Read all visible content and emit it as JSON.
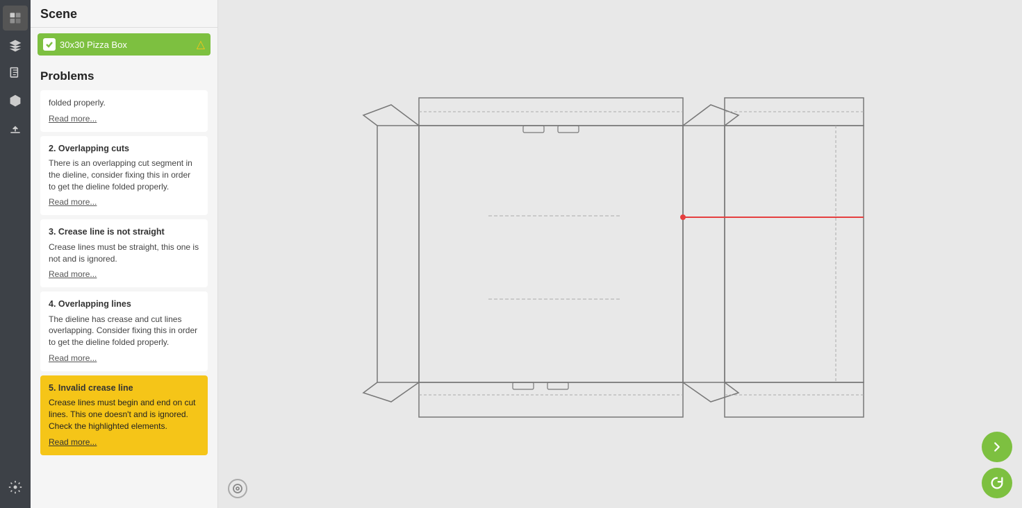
{
  "toolbar": {
    "title": "Scene",
    "tools": [
      {
        "name": "logo",
        "label": "Logo"
      },
      {
        "name": "layers",
        "label": "Layers"
      },
      {
        "name": "files",
        "label": "Files"
      },
      {
        "name": "models",
        "label": "Models"
      },
      {
        "name": "upload",
        "label": "Upload"
      }
    ],
    "settings_label": "Settings"
  },
  "sidebar": {
    "scene_title": "Scene",
    "item_label": "30x30 Pizza Box",
    "problems_title": "Problems",
    "problems": [
      {
        "id": 1,
        "title": null,
        "desc": "folded properly.",
        "read_more": "Read more...",
        "highlighted": false
      },
      {
        "id": 2,
        "title": "2. Overlapping cuts",
        "desc": "There is an overlapping cut segment in the dieline, consider fixing this in order to get the dieline folded properly.",
        "read_more": "Read more...",
        "highlighted": false
      },
      {
        "id": 3,
        "title": "3. Crease line is not straight",
        "desc": "Crease lines must be straight, this one is not and is ignored.",
        "read_more": "Read more...",
        "highlighted": false
      },
      {
        "id": 4,
        "title": "4. Overlapping lines",
        "desc": "The dieline has crease and cut lines overlapping. Consider fixing this in order to get the dieline folded properly.",
        "read_more": "Read more...",
        "highlighted": false
      },
      {
        "id": 5,
        "title": "5. Invalid crease line",
        "desc": "Crease lines must begin and end on cut lines. This one doesn't and is ignored. Check the highlighted elements.",
        "read_more": "Read more...",
        "highlighted": true
      }
    ]
  },
  "canvas": {
    "reset_tooltip": "Reset view",
    "next_label": "Next",
    "refresh_label": "Refresh"
  },
  "colors": {
    "green": "#7dc040",
    "yellow": "#f5c518",
    "red_line": "#e53e3e",
    "toolbar_bg": "#3d4147"
  }
}
